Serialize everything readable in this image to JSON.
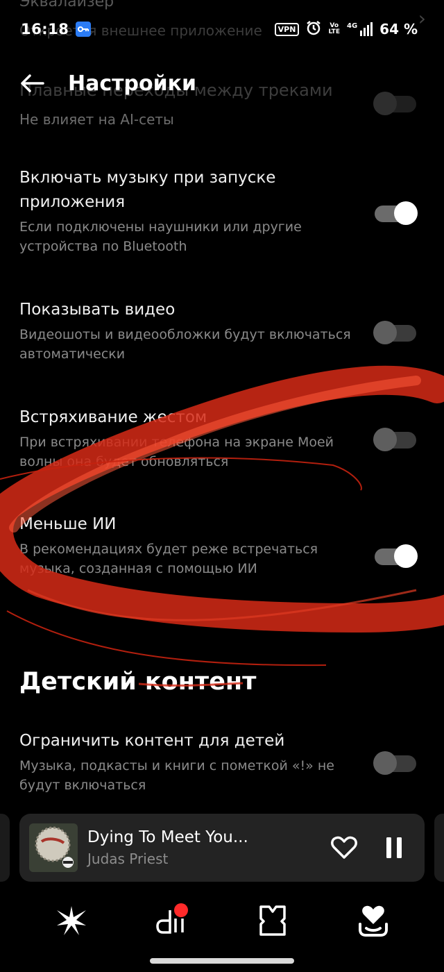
{
  "ghost_header": {
    "title": "Эквалайзер",
    "subtitle": "Откроется внешнее приложение"
  },
  "status": {
    "time": "16:18",
    "vpn": "VPN",
    "volte_top": "Vo",
    "volte_bottom": "LTE",
    "network": "4G",
    "battery": "64 %"
  },
  "header": {
    "title": "Настройки"
  },
  "ghost_row": {
    "title": "Плавные переходы между треками",
    "subtitle": "Не влияет на AI-сеты"
  },
  "settings": [
    {
      "title": "Включать музыку при запуске приложения",
      "desc": "Если подключены наушники или другие устройства по Bluetooth",
      "on": true
    },
    {
      "title": "Показывать видео",
      "desc": "Видеошоты и видеообложки будут включаться автоматически",
      "on": false
    },
    {
      "title": "Встряхивание жестом",
      "desc": "При встряхивании телефона на экране Моей волны она будет обновляться",
      "on": false
    },
    {
      "title": "Меньше ИИ",
      "desc": "В рекомендациях будет реже встречаться музыка, созданная с помощью ИИ",
      "on": true
    }
  ],
  "kids": {
    "section_title": "Детский контент",
    "title": "Ограничить контент для детей",
    "desc": "Музыка, подкасты и книги с пометкой «!» не будут включаться",
    "on": false
  },
  "player": {
    "track": "Dying To Meet You...",
    "artist": "Judas Priest"
  },
  "colors": {
    "accent_red": "#e0301e",
    "badge": "#ff2a2a",
    "toggle_on_knob": "#ffffff"
  }
}
